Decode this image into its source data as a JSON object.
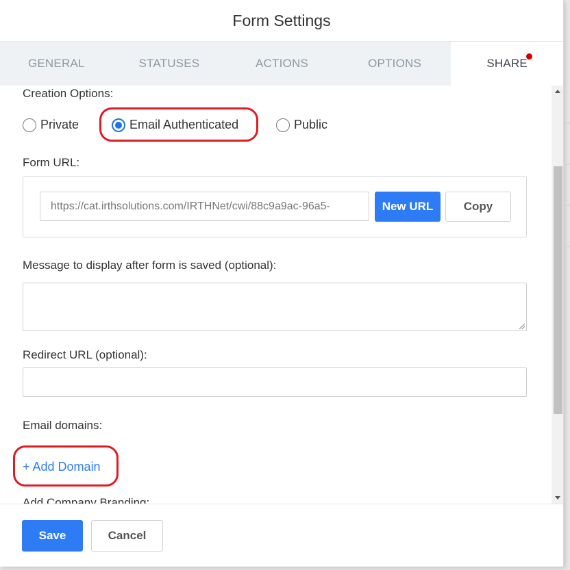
{
  "modal": {
    "title": "Form Settings"
  },
  "tabs": [
    {
      "label": "GENERAL"
    },
    {
      "label": "STATUSES"
    },
    {
      "label": "ACTIONS"
    },
    {
      "label": "OPTIONS"
    },
    {
      "label": "SHARE",
      "active": true,
      "notification": true
    }
  ],
  "share": {
    "creation_options_label": "Creation Options:",
    "radios": [
      {
        "label": "Private",
        "checked": false
      },
      {
        "label": "Email Authenticated",
        "checked": true
      },
      {
        "label": "Public",
        "checked": false
      }
    ],
    "form_url_label": "Form URL:",
    "form_url_value": "https://cat.irthsolutions.com/IRTHNet/cwi/88c9a9ac-96a5-",
    "new_url_label": "New URL",
    "copy_label": "Copy",
    "message_label": "Message to display after form is saved (optional):",
    "message_value": "",
    "redirect_label": "Redirect URL (optional):",
    "redirect_value": "",
    "email_domains_label": "Email domains:",
    "add_domain_label": "+ Add Domain",
    "company_branding_label": "Add Company Branding:"
  },
  "footer": {
    "save_label": "Save",
    "cancel_label": "Cancel"
  },
  "colors": {
    "accent": "#2d7cf6",
    "highlight": "#e01b24",
    "notification_dot": "#d40000"
  }
}
